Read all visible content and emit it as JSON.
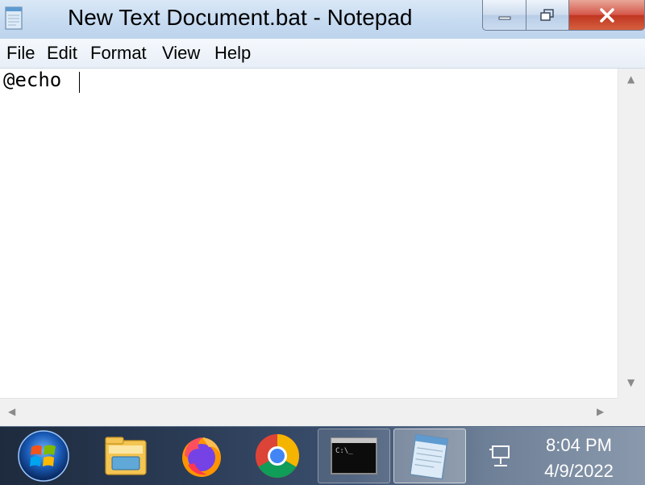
{
  "window": {
    "title": "New Text Document.bat - Notepad",
    "app_icon": "notepad-icon",
    "controls": {
      "minimize_icon": "minimize-icon",
      "maximize_icon": "restore-icon",
      "close_icon": "close-icon"
    }
  },
  "menu": {
    "items": [
      {
        "label": "File"
      },
      {
        "label": "Edit"
      },
      {
        "label": "Format"
      },
      {
        "label": "View"
      },
      {
        "label": "Help"
      }
    ]
  },
  "editor": {
    "content": "@echo "
  },
  "taskbar": {
    "start_icon": "windows-start-icon",
    "apps": [
      {
        "name": "file-explorer-icon"
      },
      {
        "name": "firefox-icon"
      },
      {
        "name": "chrome-icon"
      },
      {
        "name": "command-prompt-icon"
      },
      {
        "name": "notepad-icon"
      }
    ],
    "tray": {
      "network_icon": "network-icon",
      "time": "8:04 PM",
      "date": "4/9/2022"
    }
  },
  "colors": {
    "close_button": "#c9452f",
    "titlebar": "#c8dcf1",
    "taskbar": "#2b3c56"
  }
}
